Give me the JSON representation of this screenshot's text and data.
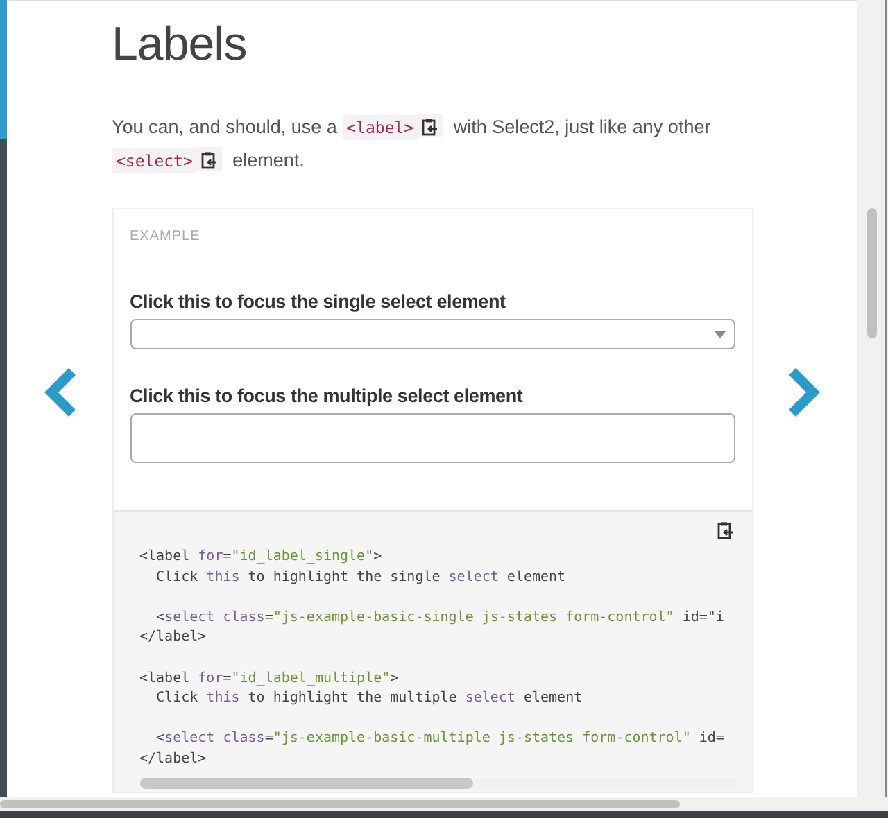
{
  "title": "Labels",
  "intro": [
    {
      "kind": "text",
      "text": "You can, and should, use a "
    },
    {
      "kind": "code",
      "text": "<label>"
    },
    {
      "kind": "text",
      "text": " with Select2, just like any other "
    },
    {
      "kind": "code",
      "text": "<select>"
    },
    {
      "kind": "text",
      "text": " element."
    }
  ],
  "example": {
    "heading": "EXAMPLE",
    "fields": [
      {
        "kind": "single",
        "label": "Click this to focus the single select element"
      },
      {
        "kind": "multiple",
        "label": "Click this to focus the multiple select element"
      }
    ]
  },
  "code_lines": [
    {
      "gap_before": false,
      "tokens": [
        {
          "kind": "plain",
          "text": "<label "
        },
        {
          "kind": "keyword",
          "text": "for"
        },
        {
          "kind": "plain",
          "text": "="
        },
        {
          "kind": "string",
          "text": "\"id_label_single\""
        },
        {
          "kind": "plain",
          "text": ">"
        }
      ]
    },
    {
      "gap_before": false,
      "tokens": [
        {
          "kind": "plain",
          "text": "  Click "
        },
        {
          "kind": "keyword",
          "text": "this"
        },
        {
          "kind": "plain",
          "text": " to highlight the single "
        },
        {
          "kind": "keyword",
          "text": "select"
        },
        {
          "kind": "plain",
          "text": " element"
        }
      ]
    },
    {
      "gap_before": true,
      "tokens": [
        {
          "kind": "plain",
          "text": "  <"
        },
        {
          "kind": "keyword",
          "text": "select class"
        },
        {
          "kind": "plain",
          "text": "="
        },
        {
          "kind": "string",
          "text": "\"js-example-basic-single js-states form-control\""
        },
        {
          "kind": "plain",
          "text": " id=\"i"
        }
      ]
    },
    {
      "gap_before": false,
      "tokens": [
        {
          "kind": "plain",
          "text": "</label>"
        }
      ]
    },
    {
      "gap_before": true,
      "tokens": [
        {
          "kind": "plain",
          "text": "<label "
        },
        {
          "kind": "keyword",
          "text": "for"
        },
        {
          "kind": "plain",
          "text": "="
        },
        {
          "kind": "string",
          "text": "\"id_label_multiple\""
        },
        {
          "kind": "plain",
          "text": ">"
        }
      ]
    },
    {
      "gap_before": false,
      "tokens": [
        {
          "kind": "plain",
          "text": "  Click "
        },
        {
          "kind": "keyword",
          "text": "this"
        },
        {
          "kind": "plain",
          "text": " to highlight the multiple "
        },
        {
          "kind": "keyword",
          "text": "select"
        },
        {
          "kind": "plain",
          "text": " element"
        }
      ]
    },
    {
      "gap_before": true,
      "tokens": [
        {
          "kind": "plain",
          "text": "  <"
        },
        {
          "kind": "keyword",
          "text": "select class"
        },
        {
          "kind": "plain",
          "text": "="
        },
        {
          "kind": "string",
          "text": "\"js-example-basic-multiple js-states form-control\""
        },
        {
          "kind": "plain",
          "text": " id="
        }
      ]
    },
    {
      "gap_before": false,
      "tokens": [
        {
          "kind": "plain",
          "text": "</label>"
        }
      ]
    }
  ]
}
